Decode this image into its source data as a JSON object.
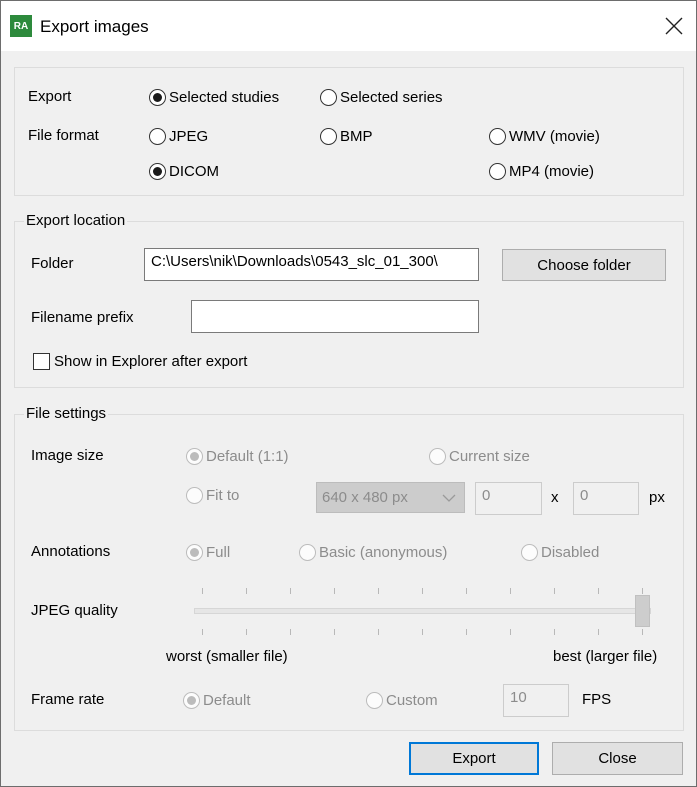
{
  "window": {
    "title": "Export images",
    "app_icon": "RA",
    "icon_color": "#2d8a3c"
  },
  "export_group": {
    "export_label": "Export",
    "options": {
      "selected_studies": "Selected studies",
      "selected_series": "Selected series"
    },
    "selected": "Selected studies",
    "format_label": "File format",
    "formats": {
      "jpeg": "JPEG",
      "bmp": "BMP",
      "wmv": "WMV (movie)",
      "dicom": "DICOM",
      "mp4": "MP4 (movie)"
    },
    "selected_format": "DICOM"
  },
  "location": {
    "legend": "Export location",
    "folder_label": "Folder",
    "folder_value": "C:\\Users\\nik\\Downloads\\0543_slc_01_300\\",
    "choose_folder": "Choose folder",
    "prefix_label": "Filename prefix",
    "prefix_value": "",
    "show_in_explorer": "Show in Explorer after export",
    "show_in_explorer_checked": false
  },
  "settings": {
    "legend": "File settings",
    "image_size_label": "Image size",
    "size_default": "Default (1:1)",
    "size_current": "Current size",
    "size_fit": "Fit to",
    "fit_select": "640 x 480 px",
    "width_value": "0",
    "height_value": "0",
    "x_label": "x",
    "px_label": "px",
    "annotations_label": "Annotations",
    "ann_full": "Full",
    "ann_basic": "Basic (anonymous)",
    "ann_disabled": "Disabled",
    "jpeg_quality_label": "JPEG quality",
    "jpeg_quality_level": 1.0,
    "slider_min_label": "worst (smaller file)",
    "slider_max_label": "best (larger file)",
    "frame_rate_label": "Frame rate",
    "fr_default": "Default",
    "fr_custom": "Custom",
    "fps_value": "10",
    "fps_label": "FPS"
  },
  "footer": {
    "export": "Export",
    "close": "Close"
  },
  "colors": {
    "accent": "#0078d7",
    "window_bg": "#f0f0f0",
    "disabled_text": "#8c8c8c"
  }
}
